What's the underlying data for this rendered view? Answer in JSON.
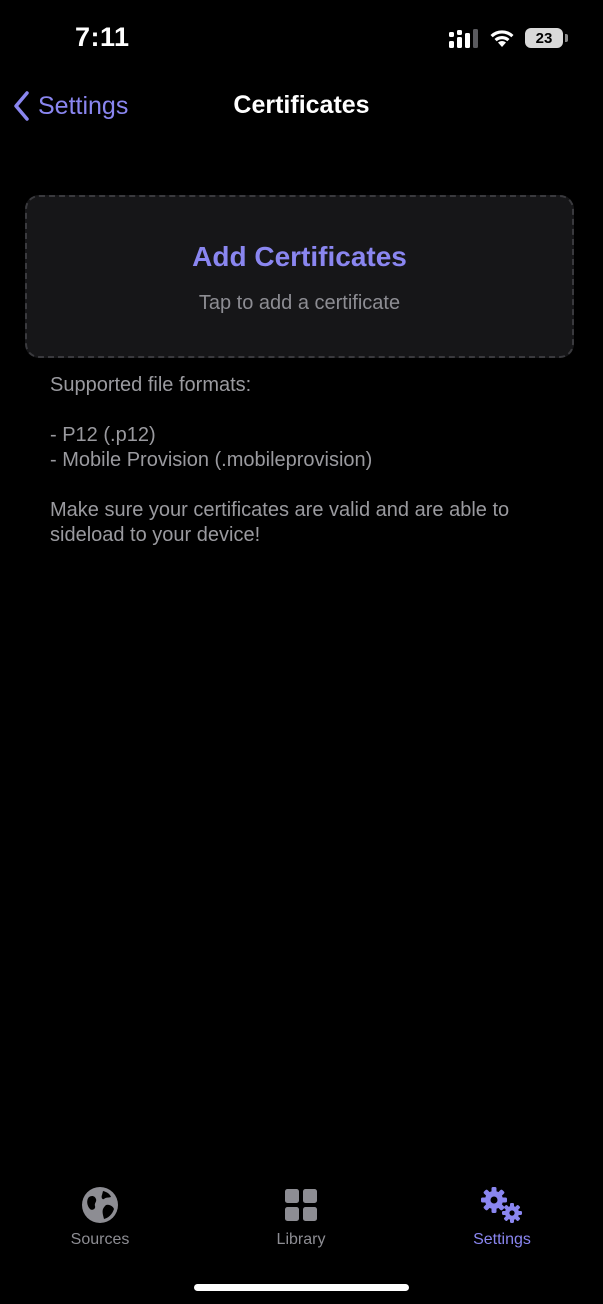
{
  "status_bar": {
    "time": "7:11",
    "battery_level": "23",
    "icons": [
      "signal-icon",
      "wifi-icon",
      "battery-icon"
    ]
  },
  "nav": {
    "back_label": "Settings",
    "title": "Certificates"
  },
  "add_card": {
    "title": "Add Certificates",
    "subtitle": "Tap to add a certificate"
  },
  "info": {
    "formats_heading": "Supported file formats:",
    "format_items": [
      "- P12 (.p12)",
      "- Mobile Provision (.mobileprovision)"
    ],
    "note": "Make sure your certificates are valid and are able to sideload to your device!"
  },
  "tab_bar": {
    "tabs": [
      {
        "label": "Sources",
        "icon": "globe-icon",
        "active": false
      },
      {
        "label": "Library",
        "icon": "grid-icon",
        "active": false
      },
      {
        "label": "Settings",
        "icon": "gears-icon",
        "active": true
      }
    ]
  },
  "colors": {
    "accent": "#8a86f0",
    "background": "#000000",
    "card_background": "#161618",
    "secondary_text": "#8d8d93"
  }
}
